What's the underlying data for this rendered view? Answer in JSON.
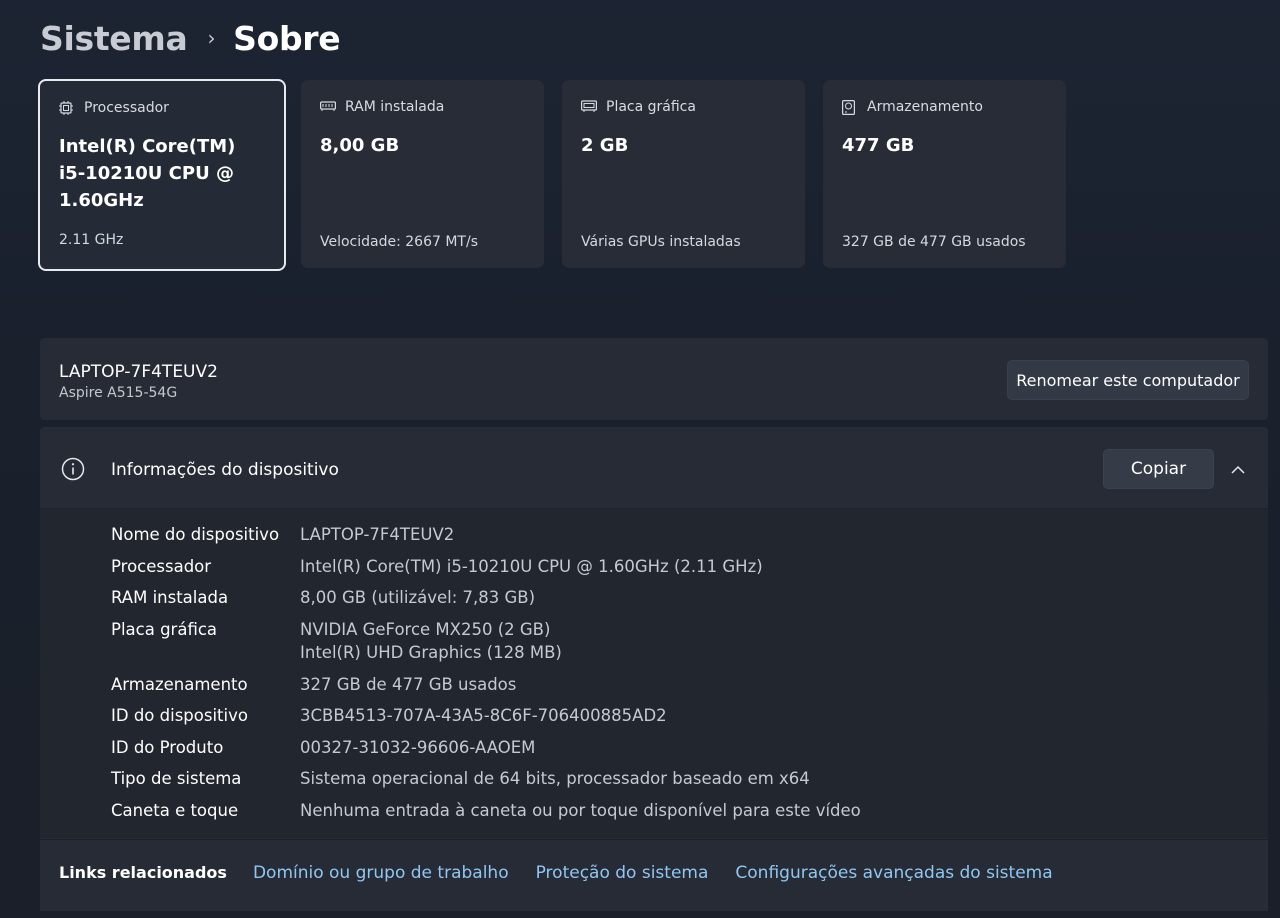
{
  "breadcrumb": {
    "parent": "Sistema",
    "separator": "›",
    "current": "Sobre"
  },
  "cards": [
    {
      "title": "Processador",
      "icon": "cpu-icon",
      "value": "Intel(R) Core(TM) i5-10210U CPU @ 1.60GHz",
      "sub": "2.11 GHz"
    },
    {
      "title": "RAM instalada",
      "icon": "ram-icon",
      "value": "8,00 GB",
      "sub": "Velocidade: 2667 MT/s"
    },
    {
      "title": "Placa gráfica",
      "icon": "gpu-icon",
      "value": "2 GB",
      "sub": "Várias GPUs instaladas"
    },
    {
      "title": "Armazenamento",
      "icon": "storage-icon",
      "value": "477 GB",
      "sub": "327 GB de 477 GB usados"
    }
  ],
  "computer": {
    "name": "LAPTOP-7F4TEUV2",
    "model": "Aspire A515-54G",
    "rename_label": "Renomear este computador"
  },
  "device_info": {
    "title": "Informações do dispositivo",
    "copy_label": "Copiar",
    "rows": [
      {
        "label": "Nome do dispositivo",
        "value": "LAPTOP-7F4TEUV2"
      },
      {
        "label": "Processador",
        "value": "Intel(R) Core(TM) i5-10210U CPU @ 1.60GHz (2.11 GHz)"
      },
      {
        "label": "RAM instalada",
        "value": "8,00 GB (utilizável: 7,83 GB)"
      },
      {
        "label": "Placa gráfica",
        "value": "NVIDIA GeForce MX250 (2 GB)",
        "value2": "Intel(R) UHD Graphics (128 MB)"
      },
      {
        "label": "Armazenamento",
        "value": "327 GB de 477 GB usados"
      },
      {
        "label": "ID do dispositivo",
        "value": "3CBB4513-707A-43A5-8C6F-706400885AD2"
      },
      {
        "label": "ID do Produto",
        "value": "00327-31032-96606-AAOEM"
      },
      {
        "label": "Tipo de sistema",
        "value": "Sistema operacional de 64 bits, processador baseado em x64"
      },
      {
        "label": "Caneta e toque",
        "value": "Nenhuma entrada à caneta ou por toque disponível para este vídeo"
      }
    ]
  },
  "related_links": {
    "label": "Links relacionados",
    "links": [
      "Domínio ou grupo de trabalho",
      "Proteção do sistema",
      "Configurações avançadas do sistema"
    ]
  },
  "colors": {
    "accent_link": "#8fc7f2",
    "panel": "#262b35",
    "background": "#1c2433"
  }
}
